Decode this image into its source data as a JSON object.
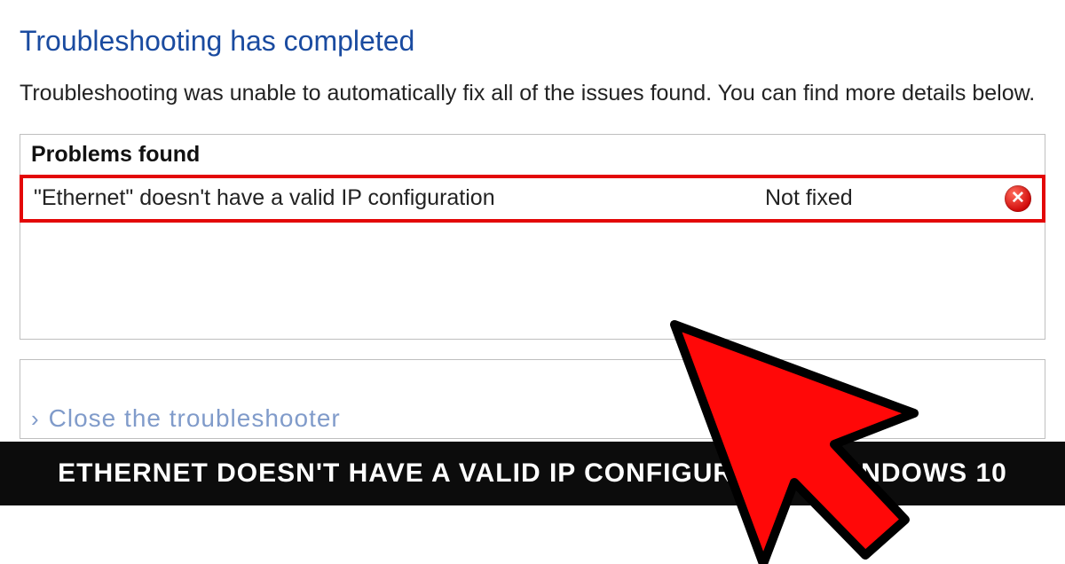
{
  "title": "Troubleshooting has completed",
  "subtitle": "Troubleshooting was unable to automatically fix all of the issues found. You can find more details below.",
  "problems_header": "Problems found",
  "problem": {
    "text": "\"Ethernet\" doesn't have a valid IP configuration",
    "status": "Not fixed"
  },
  "close_label": "Close the troubleshooter",
  "banner_text": "ETHERNET DOESN'T HAVE A VALID IP CONFIGURATION WINDOWS 10"
}
